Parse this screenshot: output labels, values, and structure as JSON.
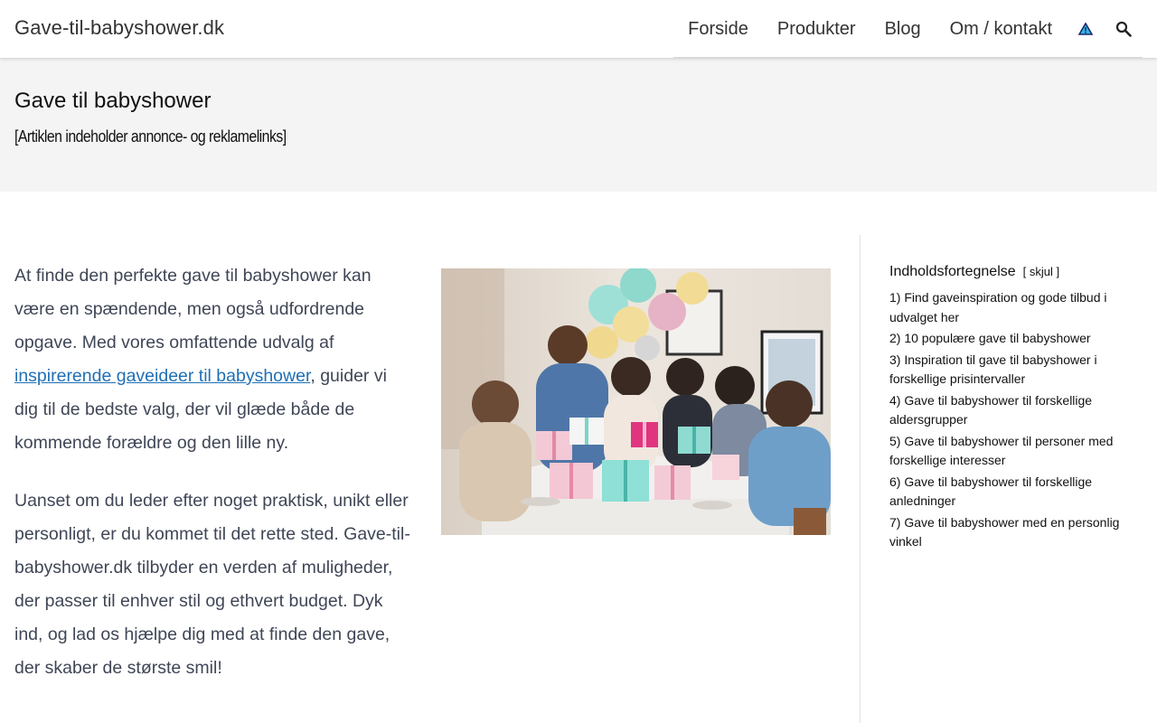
{
  "header": {
    "site_title": "Gave-til-babyshower.dk",
    "nav": [
      {
        "label": "Forside"
      },
      {
        "label": "Produkter"
      },
      {
        "label": "Blog"
      },
      {
        "label": "Om / kontakt"
      }
    ],
    "icons": {
      "warning": "warning-triangle-icon",
      "search": "search-icon"
    }
  },
  "page": {
    "title": "Gave til babyshower",
    "disclaimer": "[Artiklen indeholder annonce- og reklamelinks]"
  },
  "article": {
    "p1_before": "At finde den perfekte gave til babyshower kan være en spændende, men også udfordrende opgave. Med vores omfattende udvalg af ",
    "p1_link": "inspirerende gaveideer til babyshower",
    "p1_after": ", guider vi dig til de bedste valg, der vil glæde både de kommende forældre og den lille ny.",
    "p2": "Uanset om du leder efter noget praktisk, unikt eller personligt, er du kommet til det rette sted. Gave-til-babyshower.dk tilbyder en verden af muligheder, der passer til enhver stil og ethvert budget. Dyk ind, og lad os hjælpe dig med at finde den gave, der skaber de største smil!"
  },
  "toc": {
    "title": "Indholdsfortegnelse",
    "toggle_open": "[",
    "toggle_label": "skjul",
    "toggle_close": "]",
    "items": [
      {
        "label": "1) Find gaveinspiration og gode tilbud i udvalget her"
      },
      {
        "label": "2) 10 populære gave til babyshower"
      },
      {
        "label": "3) Inspiration til gave til babyshower i forskellige prisintervaller"
      },
      {
        "label": "4) Gave til babyshower til forskellige aldersgrupper"
      },
      {
        "label": "5) Gave til babyshower til personer med forskellige interesser"
      },
      {
        "label": "6) Gave til babyshower til forskellige anledninger"
      },
      {
        "label": "7) Gave til babyshower med en personlig vinkel"
      }
    ]
  },
  "colors": {
    "link": "#1f6fb5",
    "page_header_bg": "#f4f4f4",
    "text": "#3f4656"
  }
}
